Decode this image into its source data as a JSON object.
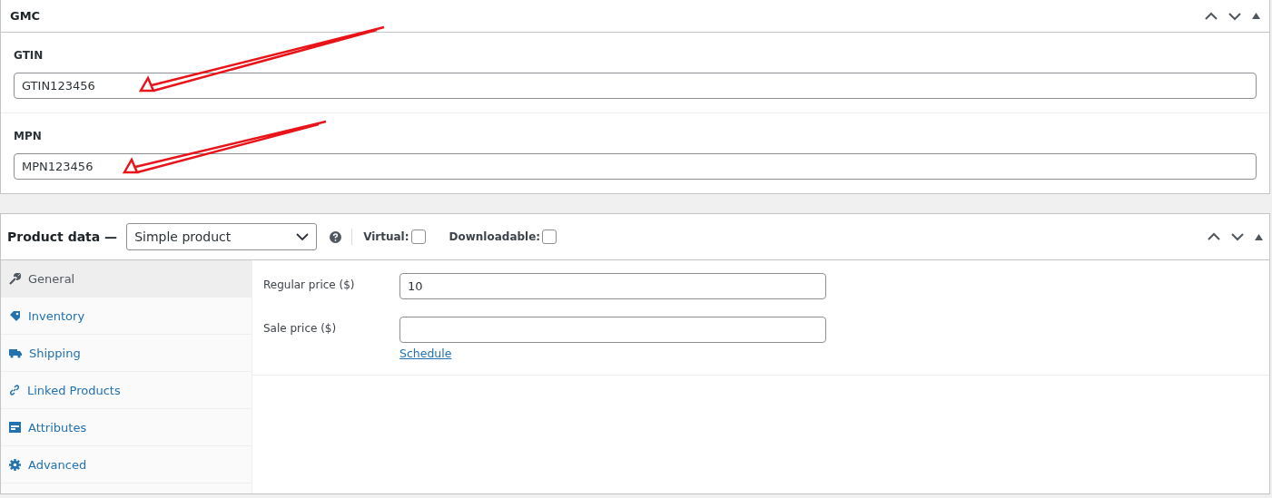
{
  "gmc_panel": {
    "title": "GMC",
    "fields": [
      {
        "label": "GTIN",
        "value": "GTIN123456"
      },
      {
        "label": "MPN",
        "value": "MPN123456"
      }
    ]
  },
  "product_data": {
    "title": "Product data —",
    "product_type": "Simple product",
    "options": [
      {
        "label": "Virtual:",
        "checked": false
      },
      {
        "label": "Downloadable:",
        "checked": false
      }
    ],
    "tabs": [
      {
        "label": "General",
        "selected": true
      },
      {
        "label": "Inventory",
        "selected": false
      },
      {
        "label": "Shipping",
        "selected": false
      },
      {
        "label": "Linked Products",
        "selected": false
      },
      {
        "label": "Attributes",
        "selected": false
      },
      {
        "label": "Advanced",
        "selected": false
      }
    ],
    "price_fields": [
      {
        "label": "Regular price ($)",
        "value": "10"
      },
      {
        "label": "Sale price ($)"
      }
    ],
    "schedule_link": "Schedule"
  }
}
